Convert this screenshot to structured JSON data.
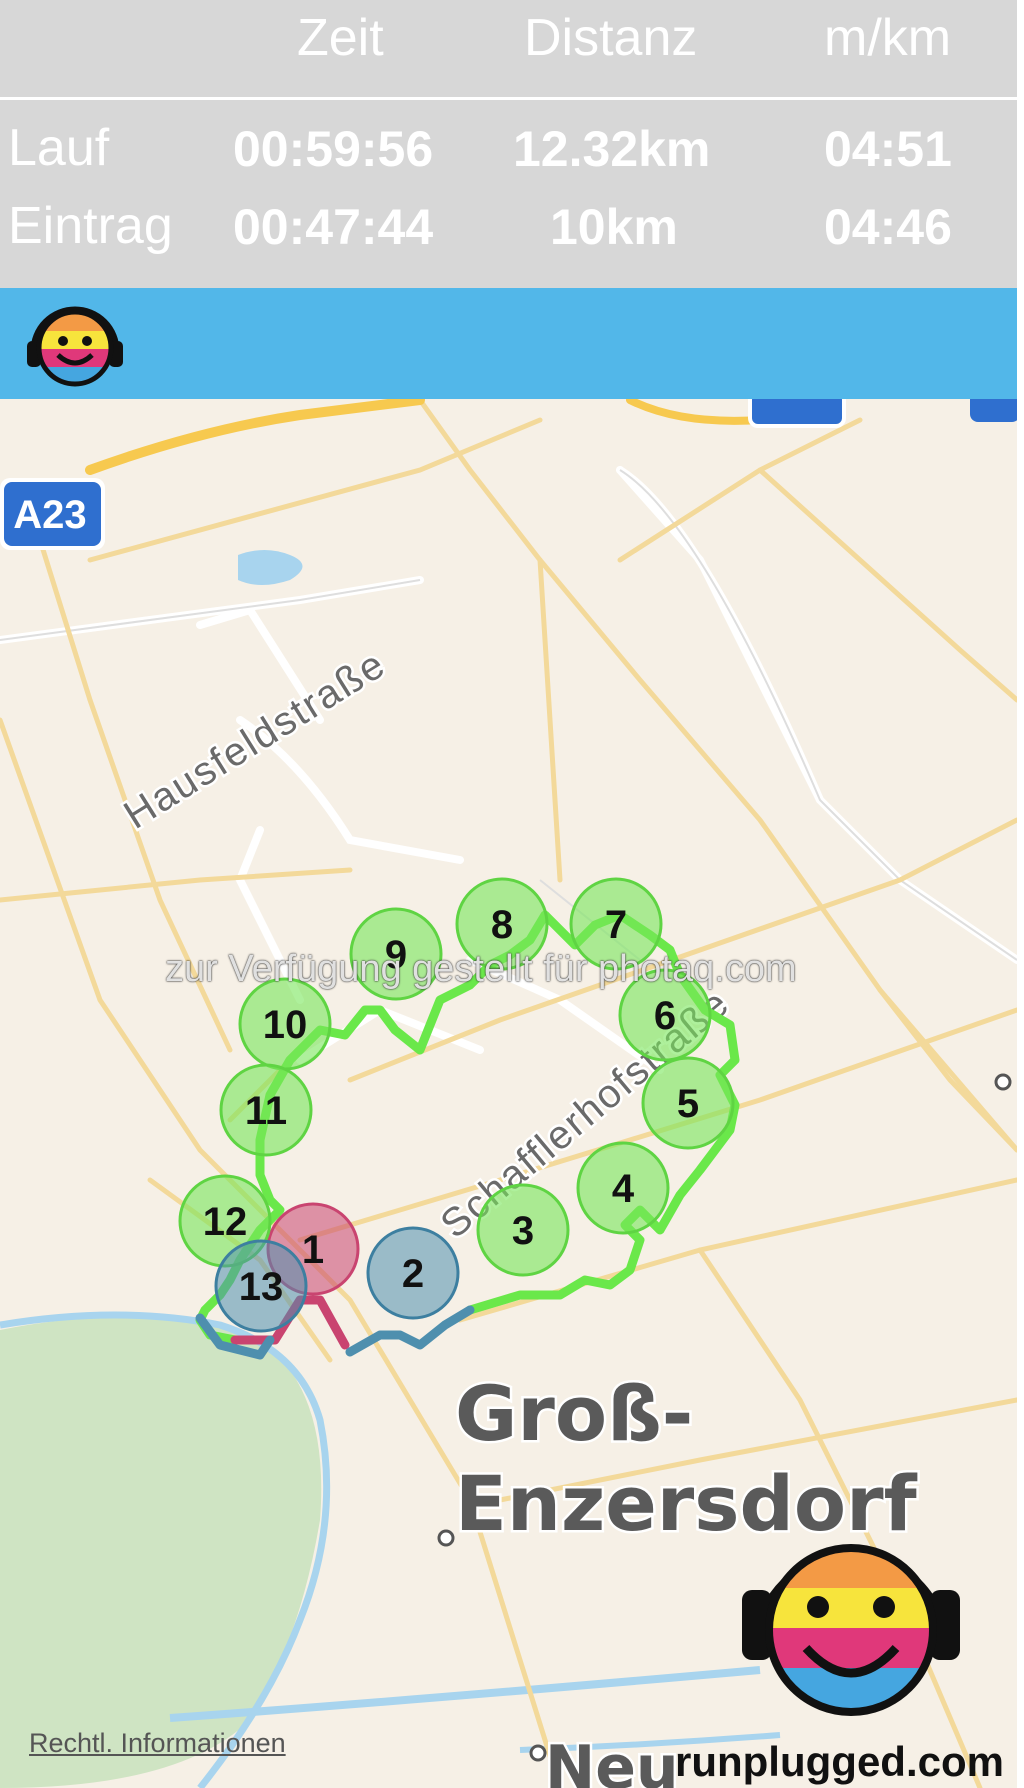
{
  "stats": {
    "headers": {
      "time": "Zeit",
      "distance": "Distanz",
      "pace": "m/km"
    },
    "rows": [
      {
        "label": "Lauf",
        "time": "00:59:56",
        "distance": "12.32km",
        "pace": "04:51"
      },
      {
        "label": "Eintrag",
        "time": "00:47:44",
        "distance": "10km",
        "pace": "04:46"
      }
    ]
  },
  "map": {
    "road_shield": "A23",
    "street_hausfeld": "Hausfeldstraße",
    "street_schaffler": "Schafflerhofstraße",
    "town_line1": "Groß-",
    "town_line2": "Enzersdorf",
    "town_bottom": "Neu",
    "markers": [
      "1",
      "2",
      "3",
      "4",
      "5",
      "6",
      "7",
      "8",
      "9",
      "10",
      "11",
      "12",
      "13"
    ]
  },
  "watermark": "zur Verfügung gestellt für photaq.com",
  "footer": {
    "legal_link": "Rechtl. Informationen",
    "brand": "runplugged.com"
  },
  "colors": {
    "bar": "#52b7e9",
    "route_green": "#6ae84a",
    "marker_green": "#8ee87a",
    "route_blue": "#4e8fae",
    "route_red": "#c94470"
  }
}
